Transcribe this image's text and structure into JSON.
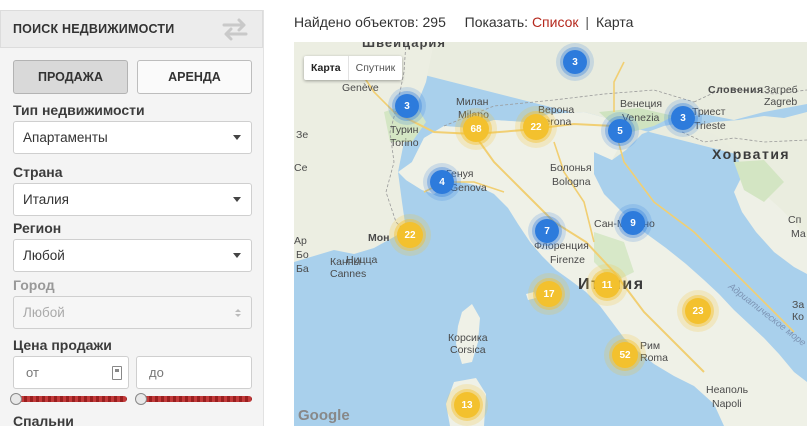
{
  "sidebar": {
    "title": "ПОИСК НЕДВИЖИМОСТИ",
    "tabs": [
      {
        "label": "ПРОДАЖА",
        "active": true
      },
      {
        "label": "АРЕНДА",
        "active": false
      }
    ],
    "property_type": {
      "label": "Тип недвижимости",
      "value": "Апартаменты"
    },
    "country": {
      "label": "Страна",
      "value": "Италия"
    },
    "region": {
      "label": "Регион",
      "value": "Любой"
    },
    "city": {
      "label": "Город",
      "value": "Любой",
      "disabled": true
    },
    "price": {
      "label": "Цена продажи",
      "from_placeholder": "от",
      "to_placeholder": "до"
    },
    "bedrooms": {
      "label": "Спальни"
    }
  },
  "results": {
    "found_label": "Найдено объектов:",
    "found_count": "295",
    "show_label": "Показать:",
    "view_list": "Список",
    "separator": "|",
    "view_map": "Карта"
  },
  "map": {
    "type_controls": [
      {
        "label": "Карта",
        "active": true
      },
      {
        "label": "Спутник",
        "active": false
      }
    ],
    "places": {
      "switzerland": "Швейцария",
      "geneve": "Genève",
      "milan_ru": "Милан",
      "milan": "Milano",
      "verona_ru": "Верона",
      "verona": "Verona",
      "venice_ru": "Венеция",
      "venice": "Venezia",
      "trieste_ru": "Триест",
      "trieste": "Trieste",
      "slovenia": "Словения",
      "zagreb_ru": "Загреб",
      "zagreb": "Zagreb",
      "croatia": "Хорватия",
      "turin_ru": "Турин",
      "turin": "Torino",
      "genoa_ru": "Генуя",
      "genoa": "Genova",
      "bologna_ru": "Болонья",
      "bologna": "Bologna",
      "sanmarino": "Сан-Марино",
      "monaco": "Мон",
      "nice": "Ницца",
      "cannes_ru": "Канны",
      "cannes": "Cannes",
      "florence_ru": "Флоренция",
      "florence": "Firenze",
      "italy": "Италия",
      "corsica_ru": "Корсика",
      "corsica": "Corsica",
      "rome_ru": "Рим",
      "rome": "Roma",
      "naples_ru": "Неаполь",
      "naples": "Napoli",
      "adriatic": "Адриатическое море",
      "sp": "Сп",
      "ma": "Ма",
      "ar": "Ар",
      "bo": "Бо",
      "ba": "Ба",
      "ze": "Зе",
      "se": "Се",
      "za": "За",
      "ko": "Ко"
    },
    "attribution": "Google",
    "clusters": [
      {
        "id": "c1",
        "count": "3",
        "color": "blue"
      },
      {
        "id": "c2",
        "count": "3",
        "color": "blue"
      },
      {
        "id": "c3",
        "count": "68",
        "color": "yellow"
      },
      {
        "id": "c4",
        "count": "22",
        "color": "yellow"
      },
      {
        "id": "c5",
        "count": "5",
        "color": "blue"
      },
      {
        "id": "c6",
        "count": "3",
        "color": "blue"
      },
      {
        "id": "c7",
        "count": "4",
        "color": "blue"
      },
      {
        "id": "c8",
        "count": "22",
        "color": "yellow"
      },
      {
        "id": "c9",
        "count": "7",
        "color": "blue"
      },
      {
        "id": "c10",
        "count": "9",
        "color": "blue"
      },
      {
        "id": "c11",
        "count": "17",
        "color": "yellow"
      },
      {
        "id": "c12",
        "count": "11",
        "color": "yellow"
      },
      {
        "id": "c13",
        "count": "23",
        "color": "yellow"
      },
      {
        "id": "c14",
        "count": "52",
        "color": "yellow"
      },
      {
        "id": "c15",
        "count": "13",
        "color": "yellow"
      }
    ]
  }
}
